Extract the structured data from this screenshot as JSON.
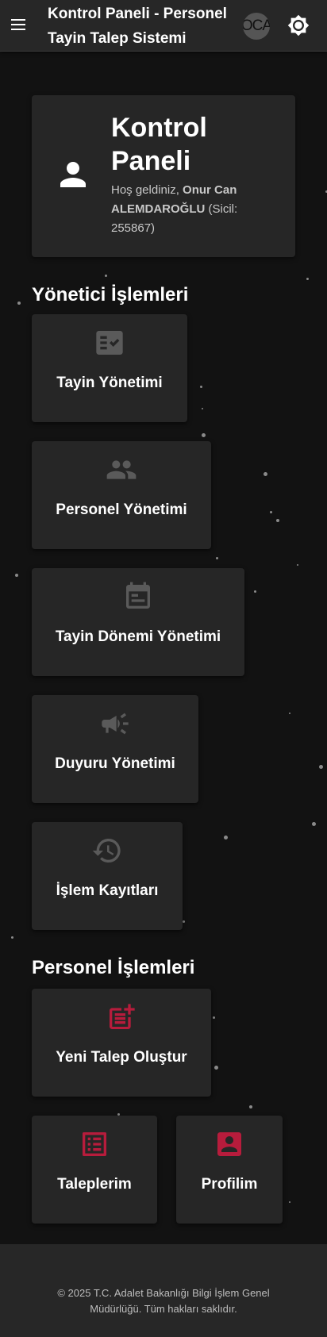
{
  "header": {
    "title": "Kontrol Paneli - Personel Tayin Talep Sistemi",
    "avatar_initials": "OCA",
    "menu_icon": "menu-icon",
    "theme_icon": "brightness-icon"
  },
  "welcome": {
    "title": "Kontrol Paneli",
    "greeting": "Hoş geldiniz, ",
    "user_name": "Onur Can ALEMDAROĞLU",
    "sicil": " (Sicil: 255867)",
    "icon": "person-icon"
  },
  "admin_section": {
    "title": "Yönetici İşlemleri",
    "items": [
      {
        "label": "Tayin Yönetimi",
        "icon": "fact-check-icon"
      },
      {
        "label": "Personel Yönetimi",
        "icon": "people-icon"
      },
      {
        "label": "Tayin Dönemi Yönetimi",
        "icon": "calendar-icon"
      },
      {
        "label": "Duyuru Yönetimi",
        "icon": "megaphone-icon"
      },
      {
        "label": "İşlem Kayıtları",
        "icon": "history-icon"
      }
    ]
  },
  "personnel_section": {
    "title": "Personel İşlemleri",
    "items": [
      {
        "label": "Yeni Talep Oluştur",
        "icon": "post-add-icon"
      },
      {
        "label": "Taleplerim",
        "icon": "list-alt-icon"
      },
      {
        "label": "Profilim",
        "icon": "account-box-icon"
      }
    ]
  },
  "footer": {
    "text": "© 2025 T.C. Adalet Bakanlığı Bilgi İşlem Genel Müdürlüğü. Tüm hakları saklıdır."
  },
  "colors": {
    "background": "#121212",
    "surface": "#262626",
    "appbar": "#272727",
    "admin_icon": "#5a5a5a",
    "personnel_icon": "#b71c3c"
  }
}
